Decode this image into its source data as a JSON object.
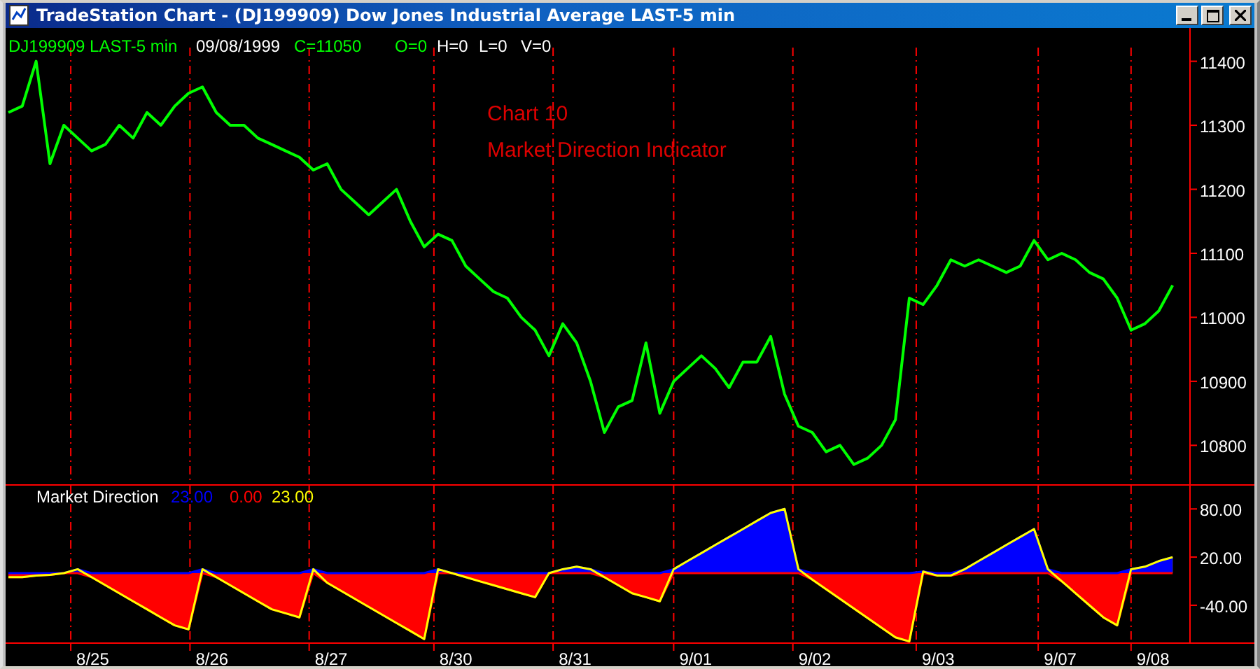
{
  "window": {
    "title": "TradeStation Chart - (DJ199909) Dow Jones Industrial Average LAST-5 min"
  },
  "price_panel": {
    "header": [
      {
        "text": "09/08/1999",
        "color": "#ffffff"
      },
      {
        "text": "C=11050",
        "color": "#00ff00"
      },
      {
        "text": "O=0",
        "color": "#00ff00"
      },
      {
        "text": "H=0",
        "color": "#ffffff"
      },
      {
        "text": "L=0",
        "color": "#ffffff"
      },
      {
        "text": "V=0",
        "color": "#ffffff"
      }
    ],
    "notes": [
      "Chart 10",
      "Market Direction Indicator"
    ],
    "chart_data": {
      "type": "line",
      "grid": true,
      "ylim": [
        10737,
        11452
      ],
      "series": [
        {
          "name": "DJ199909 LAST-5 min",
          "color": "#00ff00",
          "values": [
            11320,
            11330,
            11400,
            11240,
            11300,
            11280,
            11260,
            11270,
            11300,
            11280,
            11320,
            11300,
            11330,
            11350,
            11360,
            11320,
            11300,
            11300,
            11280,
            11270,
            11260,
            11250,
            11230,
            11240,
            11200,
            11180,
            11160,
            11180,
            11200,
            11150,
            11110,
            11130,
            11120,
            11080,
            11060,
            11040,
            11030,
            11000,
            10980,
            10940,
            10990,
            10960,
            10900,
            10820,
            10860,
            10870,
            10960,
            10850,
            10900,
            10920,
            10940,
            10920,
            10890,
            10930,
            10930,
            10970,
            10880,
            10830,
            10820,
            10790,
            10800,
            10770,
            10780,
            10800,
            10840,
            11030,
            11020,
            11050,
            11090,
            11080,
            11090,
            11080,
            11070,
            11080,
            11120,
            11090,
            11100,
            11090,
            11070,
            11060,
            11030,
            10980,
            10990,
            11010,
            11050
          ]
        }
      ],
      "yticks": [
        10800,
        10900,
        11000,
        11100,
        11200,
        11300,
        11400
      ]
    }
  },
  "indicator_panel": {
    "legend": [
      {
        "text": "23.00",
        "color": "#0000ff"
      },
      {
        "text": "0.00",
        "color": "#ff0000"
      },
      {
        "text": "23.00",
        "color": "#ffff00"
      }
    ],
    "date_axis": [
      "8/25",
      "8/26",
      "8/27",
      "8/30",
      "8/31",
      "9/01",
      "9/02",
      "9/03",
      "9/07",
      "9/08"
    ],
    "chart_data": {
      "type": "area",
      "title": "Market Direction",
      "grid": true,
      "ylim": [
        -88,
        109
      ],
      "series": [
        {
          "color": "#0000ff",
          "values": [
            0,
            0,
            0,
            0,
            0,
            5,
            0,
            0,
            0,
            0,
            0,
            0,
            0,
            0,
            5,
            0,
            0,
            0,
            0,
            0,
            0,
            0,
            5,
            0,
            0,
            0,
            0,
            0,
            0,
            0,
            0,
            5,
            0,
            0,
            0,
            0,
            0,
            0,
            0,
            0,
            5,
            8,
            5,
            0,
            0,
            0,
            0,
            0,
            5,
            15,
            25,
            35,
            45,
            55,
            65,
            75,
            80,
            5,
            0,
            0,
            0,
            0,
            0,
            0,
            0,
            0,
            2,
            0,
            0,
            5,
            15,
            25,
            35,
            45,
            55,
            5,
            0,
            0,
            0,
            0,
            0,
            5,
            8,
            15,
            20
          ]
        },
        {
          "color": "#ff0000",
          "values": [
            -5,
            -5,
            -3,
            -2,
            0,
            0,
            -5,
            -15,
            -25,
            -35,
            -45,
            -55,
            -65,
            -70,
            0,
            -5,
            -15,
            -25,
            -35,
            -45,
            -50,
            -55,
            0,
            -12,
            -22,
            -32,
            -42,
            -52,
            -62,
            -72,
            -82,
            0,
            0,
            -5,
            -10,
            -15,
            -20,
            -25,
            -30,
            0,
            0,
            0,
            0,
            -5,
            -15,
            -25,
            -30,
            -35,
            0,
            0,
            0,
            0,
            0,
            0,
            0,
            0,
            0,
            0,
            -8,
            -20,
            -32,
            -44,
            -56,
            -68,
            -80,
            -85,
            0,
            -3,
            -3,
            0,
            0,
            0,
            0,
            0,
            0,
            0,
            -10,
            -25,
            -40,
            -55,
            -65,
            0,
            0,
            0,
            0
          ]
        },
        {
          "color": "#ffff00",
          "values": [
            -5,
            -5,
            -3,
            -2,
            0,
            5,
            -5,
            -15,
            -25,
            -35,
            -45,
            -55,
            -65,
            -70,
            5,
            -5,
            -15,
            -25,
            -35,
            -45,
            -50,
            -55,
            5,
            -12,
            -22,
            -32,
            -42,
            -52,
            -62,
            -72,
            -82,
            5,
            0,
            -5,
            -10,
            -15,
            -20,
            -25,
            -30,
            0,
            5,
            8,
            5,
            -5,
            -15,
            -25,
            -30,
            -35,
            5,
            15,
            25,
            35,
            45,
            55,
            65,
            75,
            80,
            5,
            -8,
            -20,
            -32,
            -44,
            -56,
            -68,
            -80,
            -85,
            2,
            -3,
            -3,
            5,
            15,
            25,
            35,
            45,
            55,
            5,
            -10,
            -25,
            -40,
            -55,
            -65,
            5,
            8,
            15,
            20
          ]
        }
      ],
      "yticks": [
        {
          "value": 80,
          "label": "80.00"
        },
        {
          "value": 20,
          "label": "20.00"
        },
        {
          "value": -40,
          "label": "-40.00"
        }
      ]
    }
  }
}
